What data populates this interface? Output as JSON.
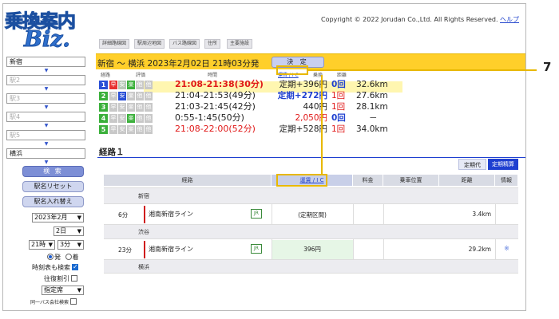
{
  "logo": {
    "line1": "乗換案内",
    "line2": "Biz."
  },
  "copyright": {
    "text": "Copyright © 2022 Jorudan Co.,Ltd. All Rights Reserved.",
    "help": "ヘルプ"
  },
  "tabs": [
    "詳細路線図",
    "駅周辺地図",
    "バス路線図",
    "住所",
    "主要施設"
  ],
  "sidebar": {
    "stations": [
      {
        "value": "新宿",
        "empty": false
      },
      {
        "value": "駅2",
        "empty": true
      },
      {
        "value": "駅3",
        "empty": true
      },
      {
        "value": "駅4",
        "empty": true
      },
      {
        "value": "駅5",
        "empty": true
      },
      {
        "value": "横浜",
        "empty": false
      }
    ],
    "arrow": "▼",
    "search_button": "検 索",
    "reset_button": "駅名リセット",
    "swap_button": "駅名入れ替え",
    "year_month": "2023年2月",
    "day": "2日",
    "hour": "21時",
    "minute": "3分",
    "radio_depart": "発",
    "radio_arrive": "着",
    "timetable_label": "時刻表も検索",
    "roundtrip_label": "往復割引",
    "seat_select": "指定席",
    "bus_label": "同一バス会社検索"
  },
  "route_bar": {
    "title": "新宿 ～ 横浜 2023年2月02日 21時03分発",
    "decide": "決 定"
  },
  "col_headers": {
    "route": "経路",
    "eval": "評価",
    "time": "時間",
    "fare": "運賃 / I C",
    "transfer": "乗換",
    "distance": "距離"
  },
  "routes": [
    {
      "num": "1",
      "time": "21:08-21:38(30分)",
      "fare": "定期+396円",
      "transfers": "0回",
      "distance": "32.6km",
      "time_style": "red bold",
      "fare_style": "",
      "trans_style": "blue"
    },
    {
      "num": "2",
      "time": "21:04-21:53(49分)",
      "fare": "定期+272円",
      "transfers": "1回",
      "distance": "27.6km",
      "time_style": "",
      "fare_style": "blue",
      "trans_style": "red"
    },
    {
      "num": "3",
      "time": "21:03-21:45(42分)",
      "fare": "440円",
      "transfers": "1回",
      "distance": "28.1km",
      "time_style": "",
      "fare_style": "",
      "trans_style": "red"
    },
    {
      "num": "4",
      "time": "0:55-1:45(50分)",
      "fare": "2,050円",
      "transfers": "0回",
      "distance": "－",
      "time_style": "",
      "fare_style": "red",
      "trans_style": "blue"
    },
    {
      "num": "5",
      "time": "21:08-22:00(52分)",
      "fare": "定期+528円",
      "transfers": "1回",
      "distance": "34.0km",
      "time_style": "red",
      "fare_style": "",
      "trans_style": "red"
    }
  ],
  "badges": {
    "fast": "早",
    "cheap": "安",
    "easy": "楽",
    "ic": "他",
    "extra": "他"
  },
  "section": {
    "title": "経路１",
    "tab_period": "定期代",
    "tab_settle": "定期精算"
  },
  "detail_headers": {
    "route": "経路",
    "fare": "運賃 / I C",
    "charge": "料金",
    "position": "乗車位置",
    "distance": "距離",
    "info": "情報"
  },
  "detail": {
    "station1": "新宿",
    "seg1": {
      "minutes": "6分",
      "line": "湘南新宿ライン",
      "operator": "JR",
      "fare": "(定期区間)",
      "distance": "3.4km"
    },
    "station2": "渋谷",
    "seg2": {
      "minutes": "23分",
      "line": "湘南新宿ライン",
      "operator": "JR",
      "fare": "396円",
      "distance": "29.2km",
      "info": "※"
    },
    "station3": "横浜"
  },
  "annotation": {
    "number": "7"
  },
  "colors": {
    "accent_yellow": "#ffcf2a",
    "brand_blue": "#1e3fd0",
    "green": "#3bb03b",
    "red": "#e01818"
  }
}
